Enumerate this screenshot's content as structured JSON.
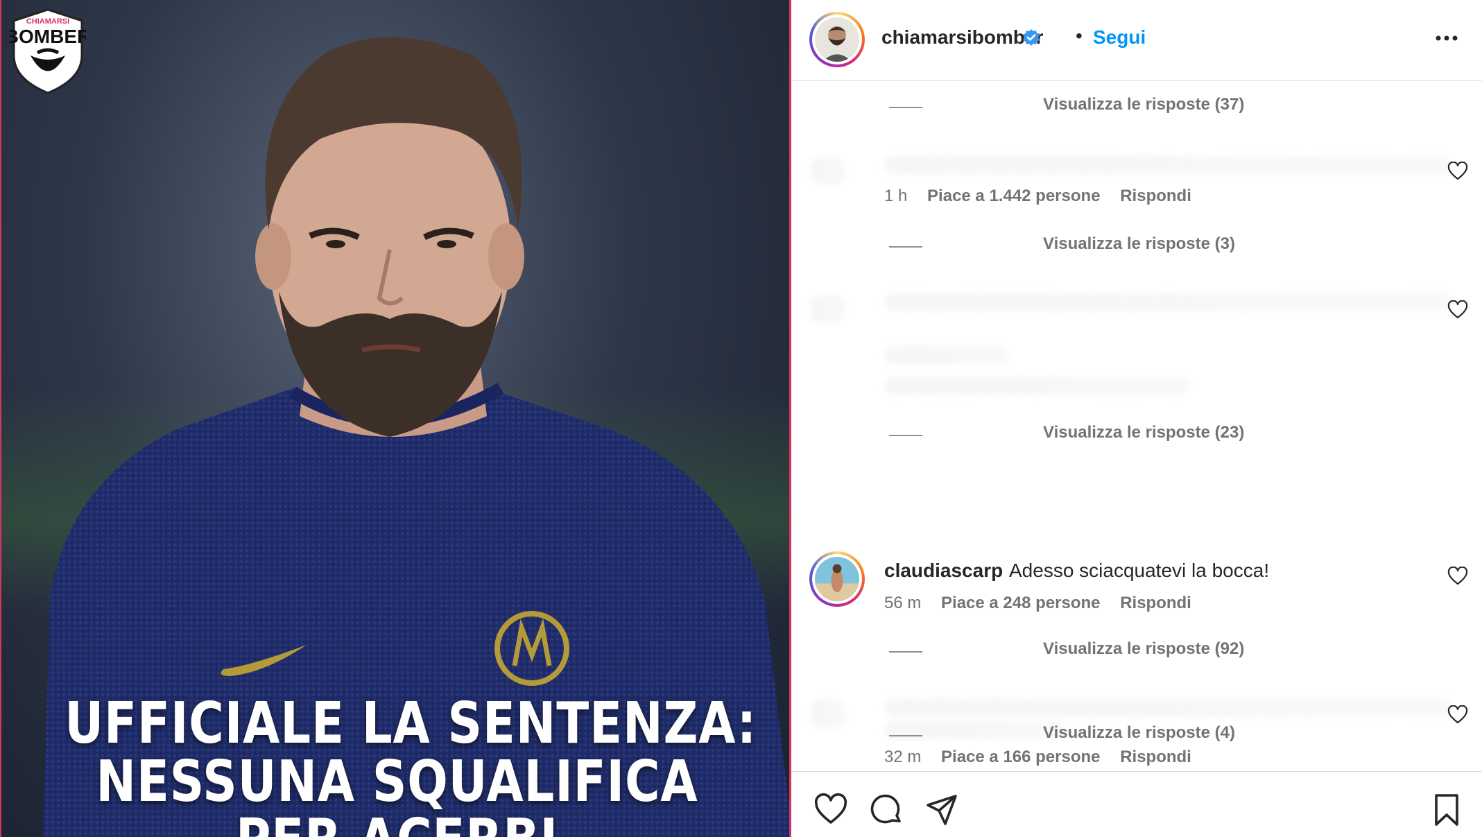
{
  "post": {
    "headline_lines": [
      "UFFICIALE LA SENTENZA:",
      "NESSUNA SQUALIFICA",
      "PER ACERBI"
    ],
    "brand_logo_text": [
      "CHIAMARSI",
      "BOMBER"
    ]
  },
  "header": {
    "username": "chiamarsibomber",
    "verified": true,
    "separator": "•",
    "follow_label": "Segui",
    "more_icon": "more-horizontal-icon"
  },
  "comments": {
    "replies_1": "Visualizza le risposte (37)",
    "c2": {
      "time": "1 h",
      "likes": "Piace a 1.442 persone",
      "reply": "Rispondi"
    },
    "replies_2": "Visualizza le risposte (3)",
    "replies_3": "Visualizza le risposte (23)",
    "c4": {
      "username": "claudiascarp",
      "text": "Adesso sciacquatevi la bocca!",
      "time": "56 m",
      "likes": "Piace a 248 persone",
      "reply": "Rispondi"
    },
    "replies_4": "Visualizza le risposte (92)",
    "c5": {
      "time": "32 m",
      "likes": "Piace a 166 persone",
      "reply": "Rispondi"
    },
    "replies_5": "Visualizza le risposte (4)"
  },
  "actions": {
    "like_icon": "heart-icon",
    "comment_icon": "comment-icon",
    "share_icon": "send-icon",
    "save_icon": "bookmark-icon"
  },
  "colors": {
    "link_blue": "#0095f6",
    "muted": "#737373",
    "border": "#dbdbdb"
  }
}
